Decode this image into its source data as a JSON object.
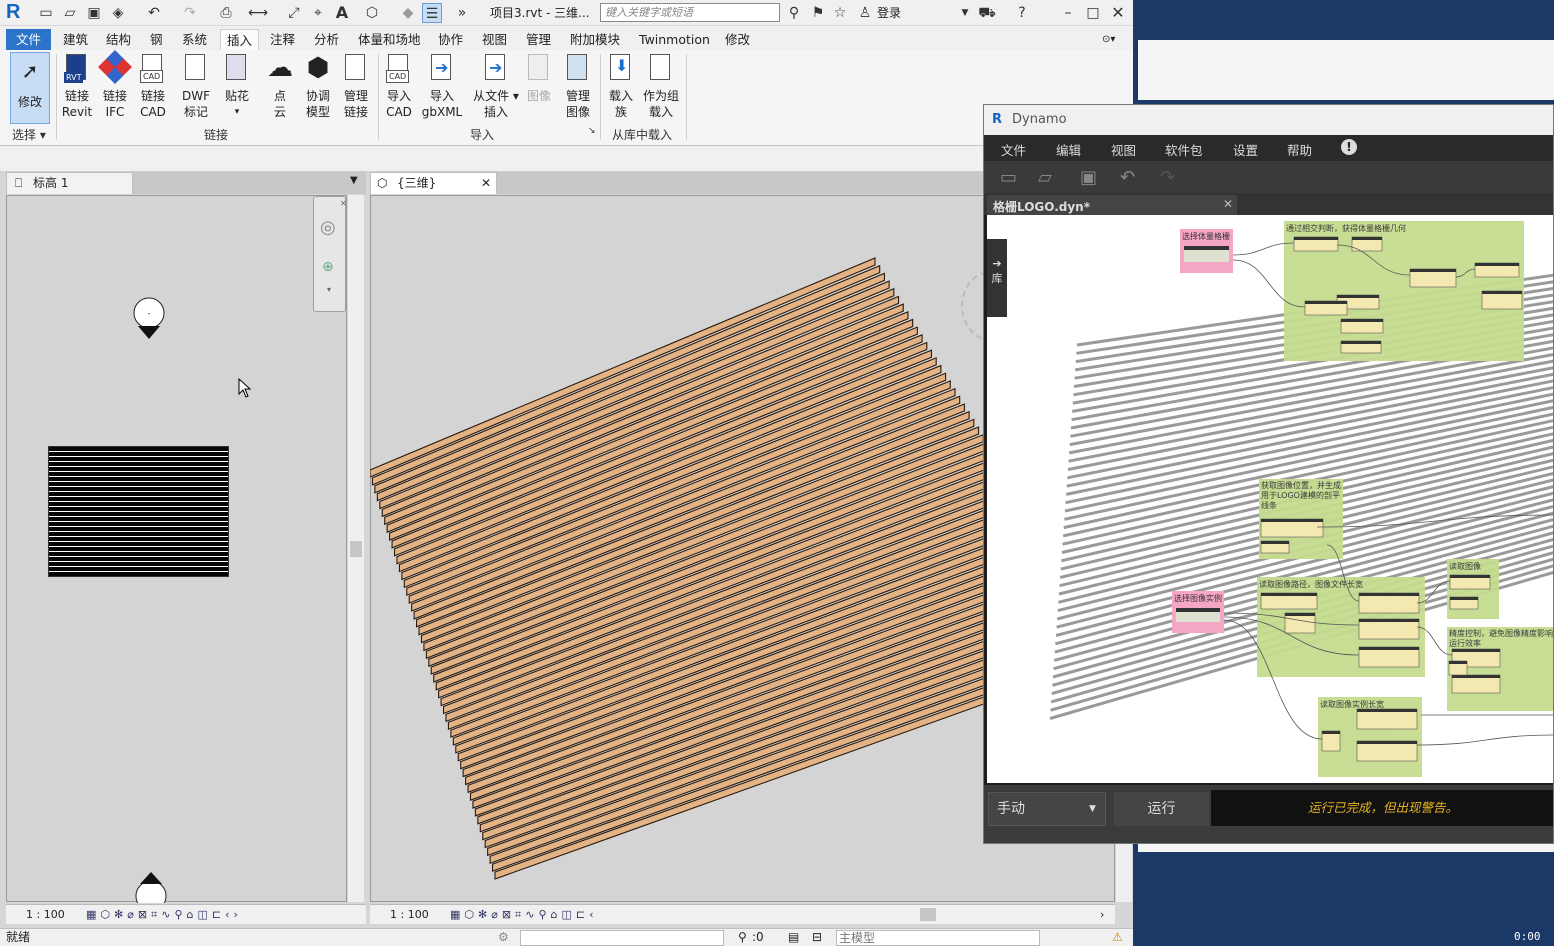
{
  "qat": {
    "title": "项目3.rvt - 三维...",
    "search_placeholder": "键入关键字或短语",
    "login": "登录"
  },
  "tabs": [
    "文件",
    "建筑",
    "结构",
    "钢",
    "系统",
    "插入",
    "注释",
    "分析",
    "体量和场地",
    "协作",
    "视图",
    "管理",
    "附加模块",
    "Twinmotion",
    "修改"
  ],
  "ribbon": {
    "select_group": "选择",
    "modify": "修改",
    "link_group": "链接",
    "import_group": "导入",
    "library_group": "从库中载入",
    "buttons": [
      {
        "l1": "链接",
        "l2": "Revit"
      },
      {
        "l1": "链接",
        "l2": "IFC"
      },
      {
        "l1": "链接",
        "l2": "CAD"
      },
      {
        "l1": "DWF",
        "l2": "标记"
      },
      {
        "l1": "贴花",
        "l2": ""
      },
      {
        "l1": "点",
        "l2": "云"
      },
      {
        "l1": "协调",
        "l2": "模型"
      },
      {
        "l1": "管理",
        "l2": "链接"
      },
      {
        "l1": "导入",
        "l2": "CAD"
      },
      {
        "l1": "导入",
        "l2": "gbXML"
      },
      {
        "l1": "从文件",
        "l2": "插入"
      },
      {
        "l1": "图像",
        "l2": ""
      },
      {
        "l1": "管理",
        "l2": "图像"
      },
      {
        "l1": "载入",
        "l2": "族"
      },
      {
        "l1": "作为组",
        "l2": "载入"
      }
    ]
  },
  "views": {
    "left_tab": "标高 1",
    "right_tab": "{三维}",
    "left_scale": "1 : 100",
    "right_scale": "1 : 100"
  },
  "status": {
    "ready": "就绪",
    "filter_count": ":0",
    "model": "主模型"
  },
  "dynamo": {
    "title": "Dynamo",
    "menu": [
      "文件",
      "编辑",
      "视图",
      "软件包",
      "设置",
      "帮助"
    ],
    "tab": "格栅LOGO.dyn*",
    "mode": "手动",
    "run": "运行",
    "message": "运行已完成，但出现警告。",
    "side_label": "库",
    "groups": {
      "g1": "选择体量格栅",
      "g2": "通过相交判断，获得体量格栅几何",
      "g3": "获取图像位置，并生成用于LOGO建模的剖平线条",
      "g4": "选择图像实例",
      "g5": "读取图像路径，图像文件长宽",
      "g6": "读取图像",
      "g7": "精度控制，避免图像精度影响运行效率",
      "g8": "读取图像实例长宽"
    }
  },
  "clock": "0:00",
  "colors": {
    "wood": "#e3b385",
    "dynamo_warning": "#e6b420",
    "file_tab": "#2b74c8"
  }
}
